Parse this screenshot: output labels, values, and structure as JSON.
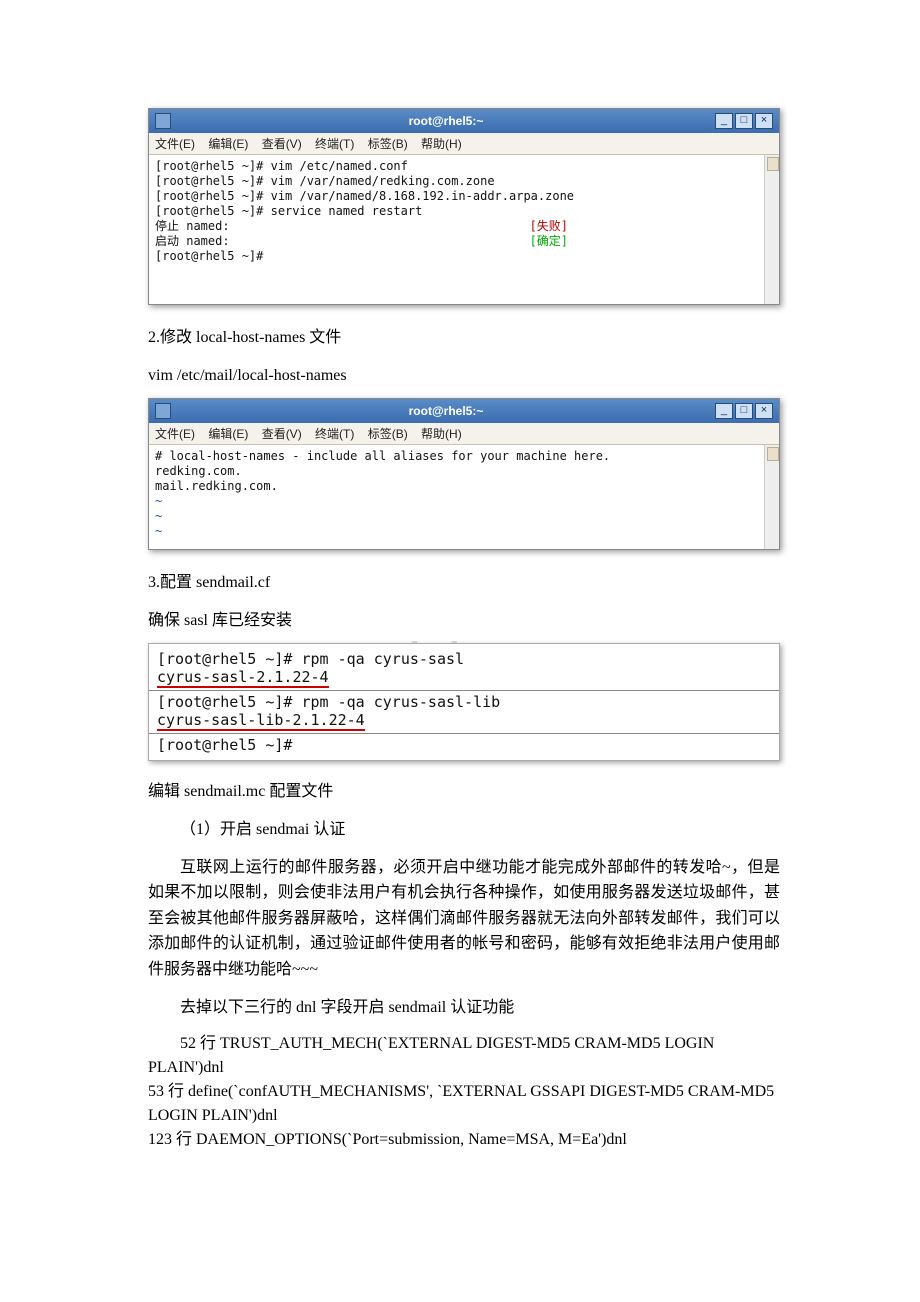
{
  "term1": {
    "title": "root@rhel5:~",
    "menu": {
      "file": "文件(E)",
      "edit": "编辑(E)",
      "view": "查看(V)",
      "terminal": "终端(T)",
      "tabs": "标签(B)",
      "help": "帮助(H)"
    },
    "lines": {
      "l1": "[root@rhel5 ~]# vim /etc/named.conf",
      "l2": "[root@rhel5 ~]# vim /var/named/redking.com.zone",
      "l3": "[root@rhel5 ~]# vim /var/named/8.168.192.in-addr.arpa.zone",
      "l4": "[root@rhel5 ~]# service named restart",
      "l5a": "停止 named:",
      "l5b": "[失败]",
      "l6a": "启动 named:",
      "l6b": "[确定]",
      "l7": "[root@rhel5 ~]#"
    },
    "controls": {
      "min": "_",
      "max": "□",
      "close": "×"
    }
  },
  "text1": "2.修改 local-host-names 文件",
  "text2": "vim /etc/mail/local-host-names",
  "term2": {
    "title": "root@rhel5:~",
    "menu": {
      "file": "文件(E)",
      "edit": "编辑(E)",
      "view": "查看(V)",
      "terminal": "终端(T)",
      "tabs": "标签(B)",
      "help": "帮助(H)"
    },
    "lines": {
      "l1": "# local-host-names - include all aliases for your machine here.",
      "l2": "redking.com.",
      "l3": "mail.redking.com.",
      "tilde": "~"
    }
  },
  "text3": "3.配置 sendmail.cf",
  "text4": "确保 sasl 库已经安装",
  "snippet": {
    "l1a": "[root@rhel5 ~]# rpm -qa cyrus-sasl",
    "l2": "cyrus-sasl-2.1.22-4",
    "l3": "[root@rhel5 ~]# rpm -qa cyrus-sasl-lib",
    "l4": "cyrus-sasl-lib-2.1.22-4",
    "l5": "[root@rhel5 ~]#"
  },
  "watermark": "www.bdocx.com",
  "text5": "编辑 sendmail.mc 配置文件",
  "text6": "（1）开启 sendmai 认证",
  "para1": "互联网上运行的邮件服务器，必须开启中继功能才能完成外部邮件的转发哈~，但是如果不加以限制，则会使非法用户有机会执行各种操作，如使用服务器发送垃圾邮件，甚至会被其他邮件服务器屏蔽哈，这样偶们滴邮件服务器就无法向外部转发邮件，我们可以添加邮件的认证机制，通过验证邮件使用者的帐号和密码，能够有效拒绝非法用户使用邮件服务器中继功能哈~~~",
  "text7": "去掉以下三行的 dnl 字段开启 sendmail 认证功能",
  "cfg": {
    "l1": "52 行 TRUST_AUTH_MECH(`EXTERNAL DIGEST-MD5 CRAM-MD5 LOGIN PLAIN')dnl",
    "l2": "53 行 define(`confAUTH_MECHANISMS', `EXTERNAL GSSAPI DIGEST-MD5 CRAM-MD5 LOGIN PLAIN')dnl",
    "l3": "123 行 DAEMON_OPTIONS(`Port=submission, Name=MSA, M=Ea')dnl"
  }
}
